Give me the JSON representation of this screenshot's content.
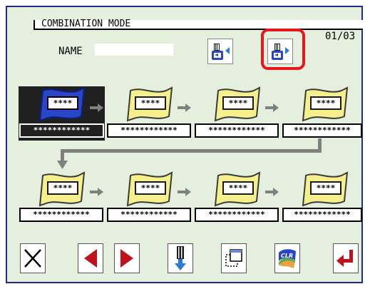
{
  "header": {
    "mode_title": "COMBINATION MODE",
    "page_indicator": "01/03",
    "name_label": "NAME",
    "name_value": ""
  },
  "toolbar": {
    "load_icon": "read-from-device-icon",
    "save_icon": "write-to-device-icon",
    "highlighted": "write-to-device-icon"
  },
  "slots": [
    {
      "pattern": "****",
      "name": "************",
      "selected": true
    },
    {
      "pattern": "****",
      "name": "************",
      "selected": false
    },
    {
      "pattern": "****",
      "name": "************",
      "selected": false
    },
    {
      "pattern": "****",
      "name": "************",
      "selected": false
    },
    {
      "pattern": "****",
      "name": "************",
      "selected": false
    },
    {
      "pattern": "****",
      "name": "************",
      "selected": false
    },
    {
      "pattern": "****",
      "name": "************",
      "selected": false
    },
    {
      "pattern": "****",
      "name": "************",
      "selected": false
    }
  ],
  "bottom_bar": {
    "buttons": [
      {
        "icon": "close-icon"
      },
      {
        "icon": "previous-arrow-icon"
      },
      {
        "icon": "next-arrow-icon"
      },
      {
        "icon": "insert-down-icon"
      },
      {
        "icon": "copy-pattern-icon"
      },
      {
        "icon": "clear-icon",
        "label": "CLR"
      },
      {
        "icon": "enter-icon"
      }
    ]
  },
  "colors": {
    "background": "#e4f0dd",
    "flag_yellow": "#f6f08c",
    "flag_selected_blue": "#2a46c8",
    "highlight_red": "#e8161d",
    "arrow_gray": "#808080",
    "nav_red": "#c0121b"
  }
}
